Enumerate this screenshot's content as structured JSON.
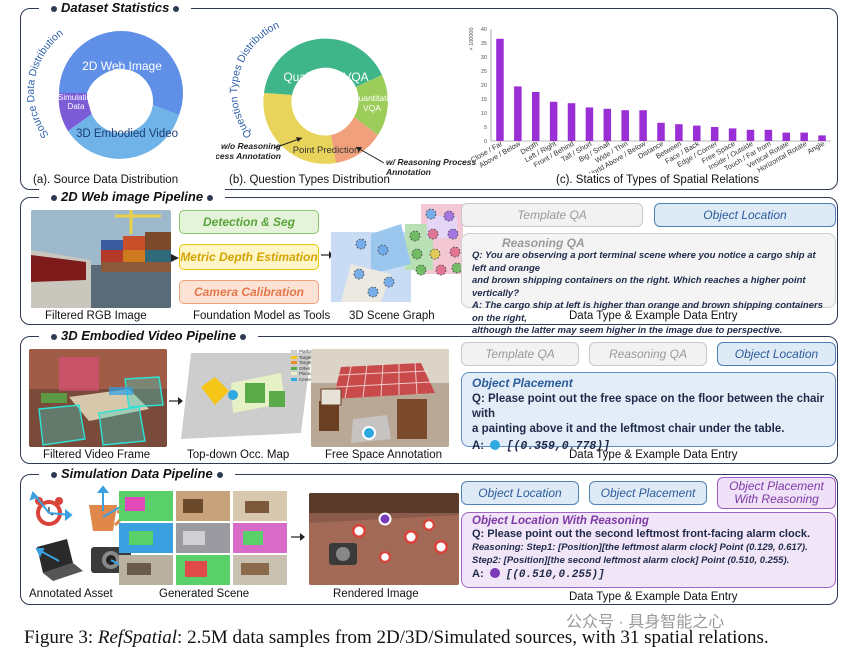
{
  "panel1": {
    "title": "Dataset Statistics",
    "donut1": {
      "ring_label": "Source Data Distribution",
      "seg_web": "2D Web Image",
      "seg_sim": "Simulation Data",
      "seg_3d": "3D Embodied Video",
      "caption": "(a). Source Data Distribution"
    },
    "donut2": {
      "ring_label": "Question Types Distribution",
      "seg_qual": "Qualitative VQA",
      "seg_quant": "Quantitative VQA",
      "seg_point": "Point Prediction",
      "note_left": "w/o Reasoning Process Annotation",
      "note_right": "w/ Reasoning Process Annotation",
      "caption": "(b). Question Types Distribution"
    },
    "bar_caption": "(c). Statics of Types of Spatial Relations"
  },
  "chart_data": {
    "type": "bar",
    "title": "",
    "ylabel": "× 100000",
    "ylim": [
      0,
      40
    ],
    "yticks": [
      0,
      5,
      10,
      15,
      20,
      25,
      30,
      35,
      40
    ],
    "categories": [
      "Close / Far",
      "Above / Below",
      "Depth",
      "Left / Right",
      "Front / Behind",
      "Tall / Short",
      "Big / Small",
      "Wide / Thin",
      "World Above / Below",
      "Distance",
      "Between",
      "Face / Back",
      "Edge / Corner",
      "Free Space",
      "Inside / Outside",
      "Touch / Far from",
      "Vertical Rotate",
      "Horizontal Rotate",
      "Angle"
    ],
    "values": [
      36.5,
      19.5,
      17.5,
      14,
      13.5,
      12,
      11.5,
      11,
      11,
      6.5,
      6,
      5.5,
      5,
      4.5,
      4,
      4,
      3,
      3,
      2
    ],
    "color": "#9b2fd6"
  },
  "panel2": {
    "title": "2D Web image Pipeline",
    "img1_caption": "Filtered RGB Image",
    "tool1": "Detection & Seg",
    "tool2": "Metric Depth Estimation",
    "tool3": "Camera Calibration",
    "tools_caption": "Foundation Model as Tools",
    "graph_caption": "3D Scene Graph",
    "tag1": "Template QA",
    "tag2": "Object Location",
    "entry_head": "Reasoning QA",
    "entry_q1": "Q: You are observing a port terminal scene where you notice a cargo ship at left and orange",
    "entry_q2": "and brown shipping containers on the right. Which reaches a higher point vertically?",
    "entry_a1": "A: The cargo ship at left is higher than orange and brown shipping containers on the right,",
    "entry_a2": "although the latter may seem higher in the image due to perspective.",
    "right_caption": "Data Type & Example Data Entry"
  },
  "panel3": {
    "title": "3D Embodied Video Pipeline",
    "img1_caption": "Filtered Video Frame",
    "occ_caption": "Top-down Occ. Map",
    "legend": [
      "Platform",
      "Target1",
      "Target2",
      "Other Obstacle",
      "Placeable Area",
      "Center"
    ],
    "img3_caption": "Free Space Annotation",
    "tag1": "Template QA",
    "tag2": "Reasoning QA",
    "tag3": "Object Location",
    "entry_head": "Object Placement",
    "entry_q1": "Q: Please point out the free space on the floor between the chair with",
    "entry_q2": "a painting above it and the leftmost chair under the table.",
    "entry_a_label": "A:",
    "entry_a_value": "[(0.359,0.778)]",
    "right_caption": "Data Type & Example Data Entry"
  },
  "panel4": {
    "title": "Simulation Data Pipeline",
    "asset_caption": "Annotated Asset",
    "scene_caption": "Generated Scene",
    "render_caption": "Rendered Image",
    "tag1": "Object Location",
    "tag2": "Object Placement",
    "tag3": "Object Placement With Reasoning",
    "entry_head": "Object Location With Reasoning",
    "entry_q": "Q: Please point out the second leftmost front-facing alarm clock.",
    "entry_r1": "Reasoning: Step1: [Position][the leftmost alarm clock] Point (0.129, 0.617).",
    "entry_r2": "Step2: [Position][the second leftmost alarm clock] Point (0.510, 0.255).",
    "entry_a_label": "A:",
    "entry_a_value": "[(0.510,0.255)]",
    "right_caption": "Data Type & Example Data Entry"
  },
  "figure_caption": {
    "prefix": "Figure 3: ",
    "name": "RefSpatial",
    "rest": ": 2.5M data samples from 2D/3D/Simulated sources, with 31 spatial relations."
  },
  "watermark": "公众号 · 具身智能之心",
  "colors": {
    "web_blue": "#5f8fe6",
    "embodied_blue": "#6fb3e8",
    "sim_purple": "#7b5cd6",
    "qual_green": "#3fb58a",
    "quant_lime": "#9ccc5a",
    "point_yellow": "#e8d45a",
    "point_orange": "#f0a07a",
    "bar_purple": "#9b2fd6"
  }
}
